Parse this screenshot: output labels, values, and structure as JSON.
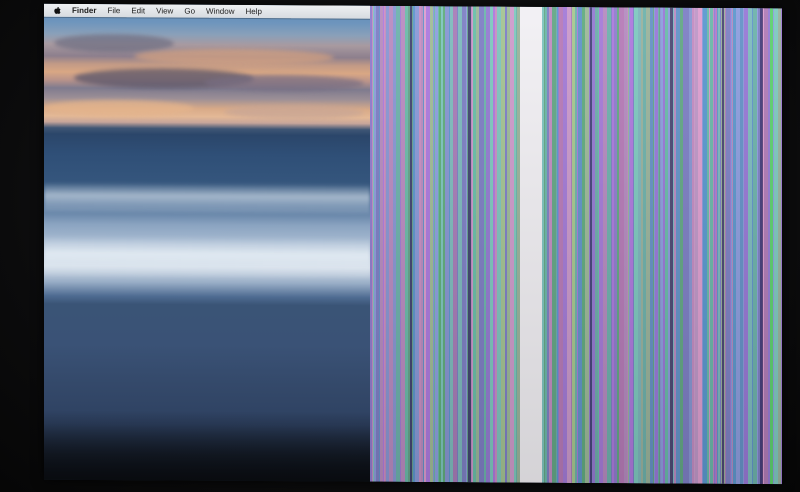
{
  "menubar": {
    "apple_icon": "apple-icon",
    "items": [
      {
        "label": "Finder",
        "app": true
      },
      {
        "label": "File",
        "app": false
      },
      {
        "label": "Edit",
        "app": false
      },
      {
        "label": "View",
        "app": false
      },
      {
        "label": "Go",
        "app": false
      },
      {
        "label": "Window",
        "app": false
      },
      {
        "label": "Help",
        "app": false
      }
    ]
  },
  "colors": {
    "menubar_bg": "#e3e6ea",
    "glitch_palette": [
      "#7f7fc8",
      "#5fb07a",
      "#c07ab8",
      "#8f9fe0",
      "#6ac0a8",
      "#d08fc4",
      "#9a7ad8",
      "#a8c890",
      "#5a9ad0",
      "#e0a0d0",
      "#7fd0c0",
      "#b07ae0"
    ],
    "glitch_bright_band": "#f2f0f4"
  }
}
